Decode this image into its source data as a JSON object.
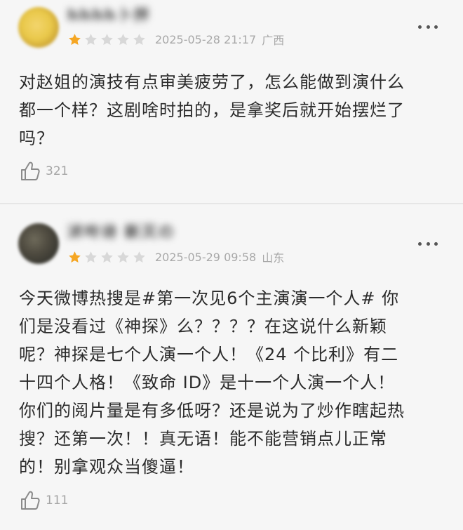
{
  "colors": {
    "star_filled": "#f5a623",
    "star_empty": "#d8d8d8",
    "meta_text": "#a8a8a8",
    "body_text": "#2b2b2b"
  },
  "reviews": [
    {
      "username": "hhhh卜拌",
      "rating": 1,
      "rating_max": 5,
      "timestamp": "2025-05-28 21:17",
      "location": "广西",
      "body_lines": [
        "对赵姐的演技有点审美疲劳了，怎么能做到演什么",
        "都一个样？这剧啥时拍的，是拿奖后就开始摆烂了",
        "吗？"
      ],
      "likes": "321",
      "icons": {
        "like": "thumbs-up-icon",
        "more": "more-dots-icon",
        "star": "star-icon"
      }
    },
    {
      "username": "沭呤诗 新灭の",
      "rating": 1,
      "rating_max": 5,
      "timestamp": "2025-05-29 09:58",
      "location": "山东",
      "body_lines": [
        "今天微博热搜是#第一次见6个主演演一个人# 你",
        "们是没看过《神探》么？？？？在这说什么新颖",
        "呢？神探是七个人演一个人！《24 个比利》有二",
        "十四个人格！《致命 ID》是十一个人演一个人！",
        "你们的阅片量是有多低呀？还是说为了炒作瞎起热",
        "搜？还第一次！！真无语！能不能营销点儿正常",
        "的！别拿观众当傻逼！"
      ],
      "likes": "111",
      "icons": {
        "like": "thumbs-up-icon",
        "more": "more-dots-icon",
        "star": "star-icon"
      }
    }
  ]
}
